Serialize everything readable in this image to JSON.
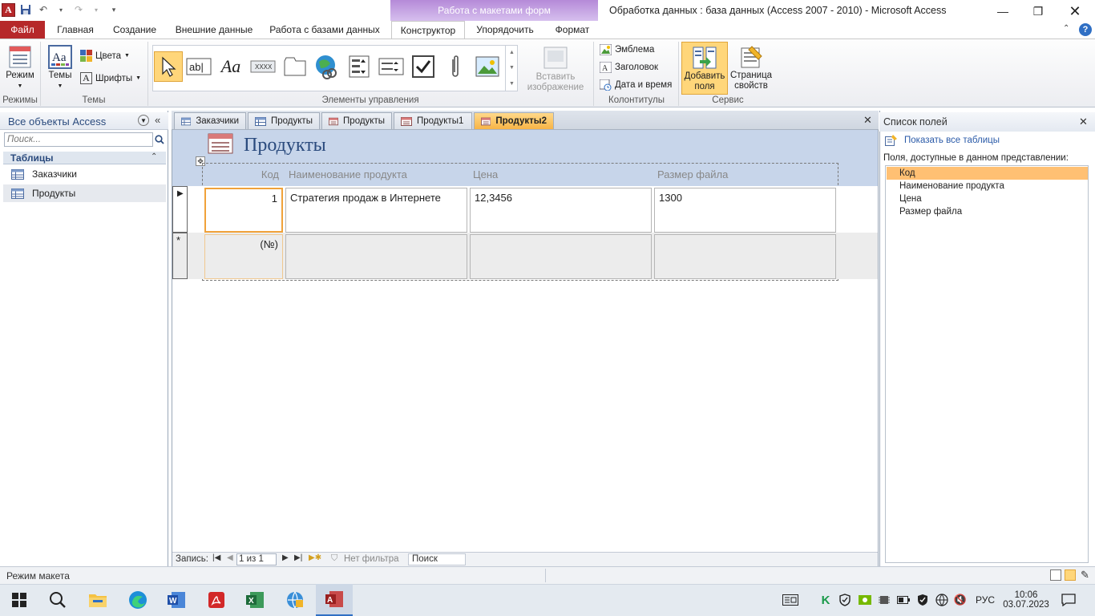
{
  "titlebar": {
    "context_tab_title": "Работа с макетами форм",
    "window_title": "Обработка данных : база данных (Access 2007 - 2010)  -  Microsoft Access",
    "qat_app_icon": "A"
  },
  "ribbon_tabs": [
    "Файл",
    "Главная",
    "Создание",
    "Внешние данные",
    "Работа с базами данных",
    "Конструктор",
    "Упорядочить",
    "Формат"
  ],
  "active_tab": "Конструктор",
  "ribbon": {
    "mode_label": "Режим",
    "themes_label": "Темы",
    "colors_label": "Цвета",
    "fonts_label": "Шрифты",
    "insert_image_label": "Вставить изображение",
    "emblem_label": "Эмблема",
    "heading_label": "Заголовок",
    "datetime_label": "Дата и время",
    "add_fields_label": "Добавить поля",
    "property_sheet_label": "Страница свойств",
    "groups": {
      "modes": "Режимы",
      "themes": "Темы",
      "controls": "Элементы управления",
      "header_footer": "Колонтитулы",
      "tools": "Сервис"
    }
  },
  "nav": {
    "header": "Все объекты Access",
    "search_placeholder": "Поиск...",
    "category": "Таблицы",
    "items": [
      "Заказчики",
      "Продукты"
    ]
  },
  "doc_tabs": [
    "Заказчики",
    "Продукты",
    "Продукты",
    "Продукты1",
    "Продукты2"
  ],
  "form": {
    "title": "Продукты",
    "columns": [
      "Код",
      "Наименование продукта",
      "Цена",
      "Размер файла"
    ],
    "row1": [
      "1",
      "Стратегия продаж в Интернете",
      "12,3456",
      "1300"
    ],
    "new_row_placeholder": "(№)"
  },
  "recordbar": {
    "record_label": "Запись:",
    "position": "1 из 1",
    "filter": "Нет фильтра",
    "search": "Поиск"
  },
  "fieldlist": {
    "title": "Список полей",
    "show_all": "Показать все таблицы",
    "available": "Поля, доступные в данном представлении:",
    "fields": [
      "Код",
      "Наименование продукта",
      "Цена",
      "Размер файла"
    ]
  },
  "statusbar": {
    "text": "Режим макета"
  },
  "taskbar": {
    "lang": "РУС",
    "time": "10:06",
    "date": "03.07.2023"
  },
  "colors": {
    "file_tab": "#b6282a",
    "context_purple": "#b58ad8",
    "active_doc_tab": "#f7b446",
    "form_header": "#c7d5ea",
    "selected_field": "#ffc073"
  }
}
